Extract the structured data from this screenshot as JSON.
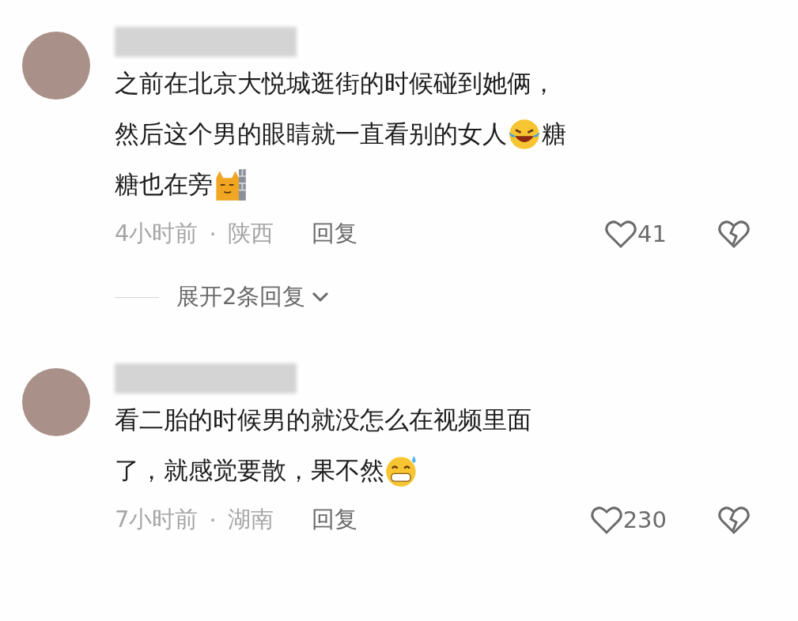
{
  "comments": [
    {
      "lines": [
        [
          {
            "kind": "text",
            "text": "之前在北京大悦城逛街的时候碰到她俩，"
          }
        ],
        [
          {
            "kind": "text",
            "text": "然后这个男的眼睛就一直看别的女人"
          },
          {
            "kind": "laughing-tears"
          },
          {
            "kind": "text",
            "text": "糖"
          }
        ],
        [
          {
            "kind": "text",
            "text": "糖也在旁"
          },
          {
            "kind": "cat"
          }
        ]
      ],
      "time": "4小时前",
      "separator": "·",
      "region": "陕西",
      "reply": "回复",
      "likes": "41",
      "expand": "展开2条回复"
    },
    {
      "lines": [
        [
          {
            "kind": "text",
            "text": "看二胎的时候男的就没怎么在视频里面"
          }
        ],
        [
          {
            "kind": "text",
            "text": "了，就感觉要散，果不然"
          },
          {
            "kind": "grin-sweat"
          }
        ]
      ],
      "time": "7小时前",
      "separator": "·",
      "region": "湖南",
      "reply": "回复",
      "likes": "230"
    }
  ]
}
